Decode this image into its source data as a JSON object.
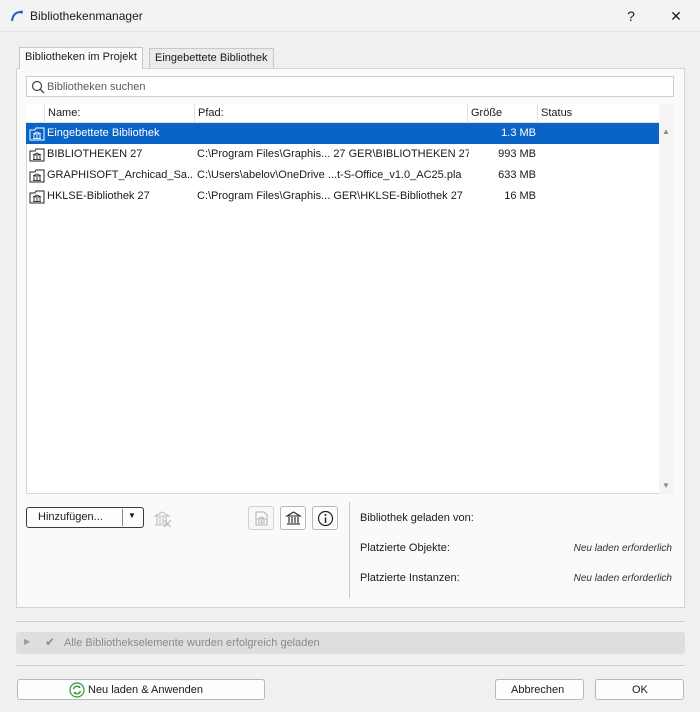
{
  "window": {
    "title": "Bibliothekenmanager",
    "help": "?",
    "close": "✕"
  },
  "tabs": [
    {
      "label": "Bibliotheken im Projekt",
      "active": true
    },
    {
      "label": "Eingebettete Bibliothek",
      "active": false
    }
  ],
  "search": {
    "placeholder": "Bibliotheken suchen"
  },
  "table": {
    "columns": [
      "Name:",
      "Pfad:",
      "Größe",
      "Status"
    ],
    "rows": [
      {
        "name": "Eingebettete Bibliothek",
        "path": "",
        "size": "1.3 MB",
        "status": "",
        "selected": true,
        "icon": "embedded-library-icon"
      },
      {
        "name": "BIBLIOTHEKEN 27",
        "path": "C:\\Program Files\\Graphis... 27 GER\\BIBLIOTHEKEN 27",
        "size": "993 MB",
        "status": "",
        "selected": false,
        "icon": "library-folder-icon"
      },
      {
        "name": "GRAPHISOFT_Archicad_Sa...",
        "path": "C:\\Users\\abelov\\OneDrive ...t-S-Office_v1.0_AC25.pla",
        "size": "633 MB",
        "status": "",
        "selected": false,
        "icon": "library-folder-icon"
      },
      {
        "name": "HKLSE-Bibliothek 27",
        "path": "C:\\Program Files\\Graphis... GER\\HKLSE-Bibliothek 27",
        "size": "16 MB",
        "status": "",
        "selected": false,
        "icon": "library-folder-icon"
      }
    ]
  },
  "actions": {
    "add_label": "Hinzufügen..."
  },
  "info": {
    "loaded_from_label": "Bibliothek geladen von:",
    "loaded_from_value": "",
    "placed_objects_label": "Platzierte Objekte:",
    "placed_objects_value": "Neu laden erforderlich",
    "placed_instances_label": "Platzierte Instanzen:",
    "placed_instances_value": "Neu laden erforderlich"
  },
  "status": {
    "text": "Alle Bibliothekselemente wurden erfolgreich geladen"
  },
  "footer": {
    "reload_label": "Neu laden & Anwenden",
    "cancel_label": "Abbrechen",
    "ok_label": "OK"
  },
  "colors": {
    "selection": "#0a64c7",
    "reload_icon": "#2f9a3a"
  }
}
